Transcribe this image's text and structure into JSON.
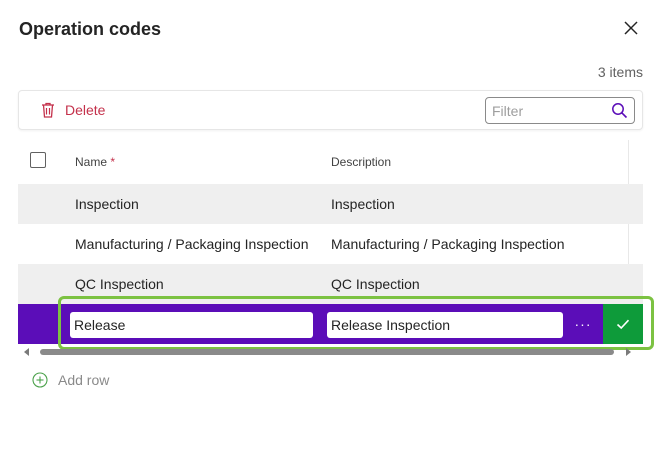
{
  "dialog": {
    "title": "Operation codes",
    "item_count": "3 items"
  },
  "toolbar": {
    "delete_label": "Delete",
    "filter_placeholder": "Filter"
  },
  "table": {
    "columns": {
      "name": "Name",
      "required_mark": "*",
      "description": "Description"
    },
    "rows": [
      {
        "name": "Inspection",
        "description": "Inspection"
      },
      {
        "name": "Manufacturing / Packaging Inspection",
        "description": "Manufacturing / Packaging Inspection"
      },
      {
        "name": "QC Inspection",
        "description": "QC Inspection"
      }
    ],
    "editing_row": {
      "name": "Release",
      "description": "Release Inspection",
      "more_label": "···"
    }
  },
  "add_row_label": "Add row",
  "colors": {
    "accent_purple": "#5b0db8",
    "confirm_green": "#0e9b3a",
    "delete_red": "#c4314b",
    "highlight_green": "#7cc242"
  }
}
